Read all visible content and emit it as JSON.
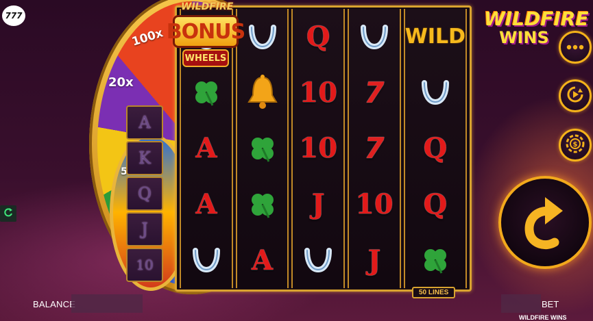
{
  "branding": {
    "corner_logo": "777",
    "game_logo_line1": "WILDFIRE",
    "game_logo_line2": "WINS",
    "bonus_logo_top": "WILDFIRE",
    "bonus_logo_main": "BONUS",
    "bonus_logo_bottom": "WHEELS"
  },
  "wheel": {
    "labels": [
      "100x",
      "20x",
      "5"
    ]
  },
  "card_stack": [
    "A",
    "K",
    "Q",
    "J",
    "10"
  ],
  "reels": [
    [
      "horseshoe",
      "clover",
      "A",
      "A",
      "horseshoe"
    ],
    [
      "horseshoe",
      "bell",
      "clover",
      "clover",
      "A"
    ],
    [
      "Q",
      "10",
      "10",
      "J",
      "horseshoe"
    ],
    [
      "horseshoe",
      "7",
      "7",
      "10",
      "J"
    ],
    [
      "WILD",
      "horseshoe",
      "Q",
      "Q",
      "clover"
    ]
  ],
  "lines_badge": "50 LINES",
  "controls": {
    "menu": "menu-icon",
    "autoplay": "autoplay-icon",
    "bet_settings": "chip-icon",
    "spin": "spin-icon",
    "refresh": "refresh-icon"
  },
  "bottom_bar": {
    "balance_label": "BALANCE",
    "balance_value": "",
    "bet_label": "BET",
    "bet_value": "",
    "game_name": "WILDFIRE WINS"
  },
  "colors": {
    "gold": "#f2a91c",
    "symbol_red": "#e21a1a",
    "clover_green": "#2fa43a",
    "horseshoe_blue": "#9fc6e8"
  }
}
